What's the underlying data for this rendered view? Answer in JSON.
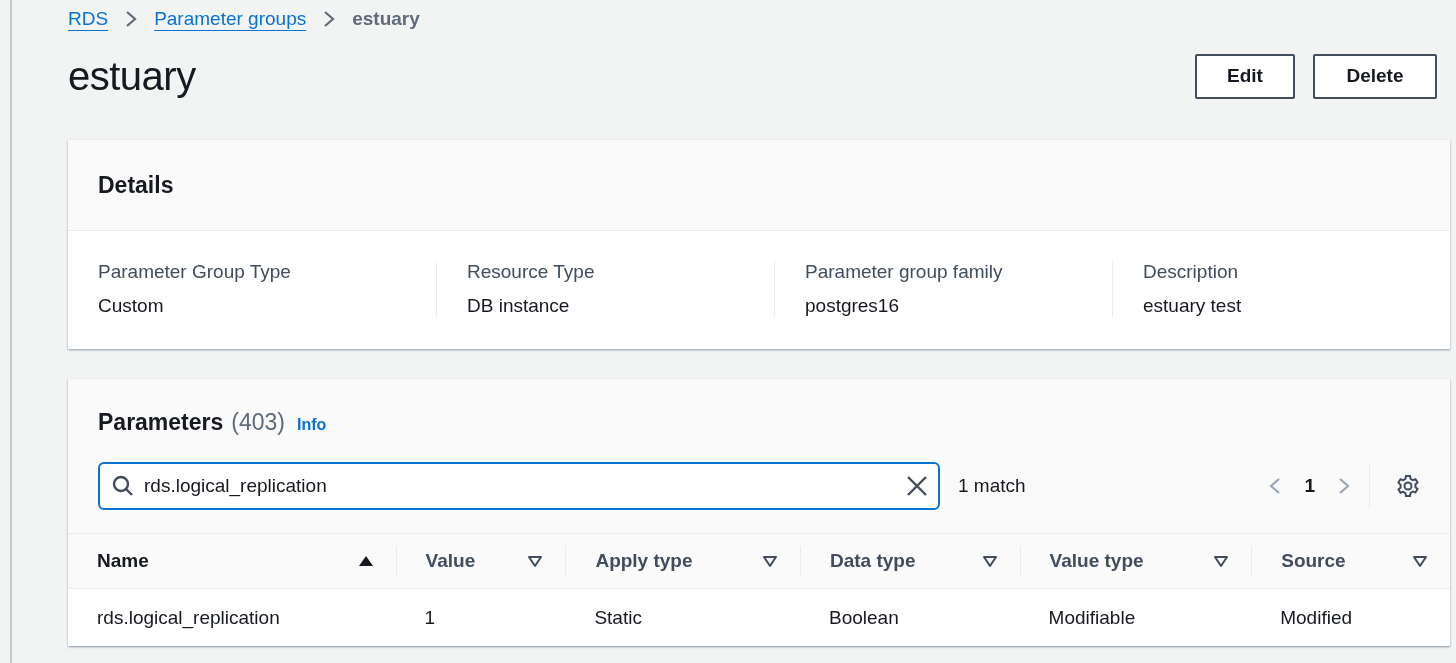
{
  "breadcrumbs": [
    {
      "label": "RDS",
      "kind": "link"
    },
    {
      "label": "Parameter groups",
      "kind": "link"
    },
    {
      "label": "estuary",
      "kind": "current"
    }
  ],
  "title": "estuary",
  "actions": [
    "Edit",
    "Delete"
  ],
  "details": {
    "heading": "Details",
    "fields": [
      {
        "label": "Parameter Group Type",
        "value": "Custom"
      },
      {
        "label": "Resource Type",
        "value": "DB instance"
      },
      {
        "label": "Parameter group family",
        "value": "postgres16"
      },
      {
        "label": "Description",
        "value": "estuary test"
      }
    ]
  },
  "parameters": {
    "heading": "Parameters",
    "count": "(403)",
    "info": "Info",
    "search": {
      "value": "rds.logical_replication"
    },
    "match": "1 match",
    "pagination": {
      "page": "1",
      "prev_disabled": true,
      "next_disabled": true
    },
    "columns": [
      {
        "label": "Name",
        "sorted": true
      },
      {
        "label": "Value",
        "sorted": false
      },
      {
        "label": "Apply type",
        "sorted": false
      },
      {
        "label": "Data type",
        "sorted": false
      },
      {
        "label": "Value type",
        "sorted": false
      },
      {
        "label": "Source",
        "sorted": false
      }
    ],
    "rows": [
      [
        "rds.logical_replication",
        "1",
        "Static",
        "Boolean",
        "Modifiable",
        "Modified"
      ]
    ]
  }
}
